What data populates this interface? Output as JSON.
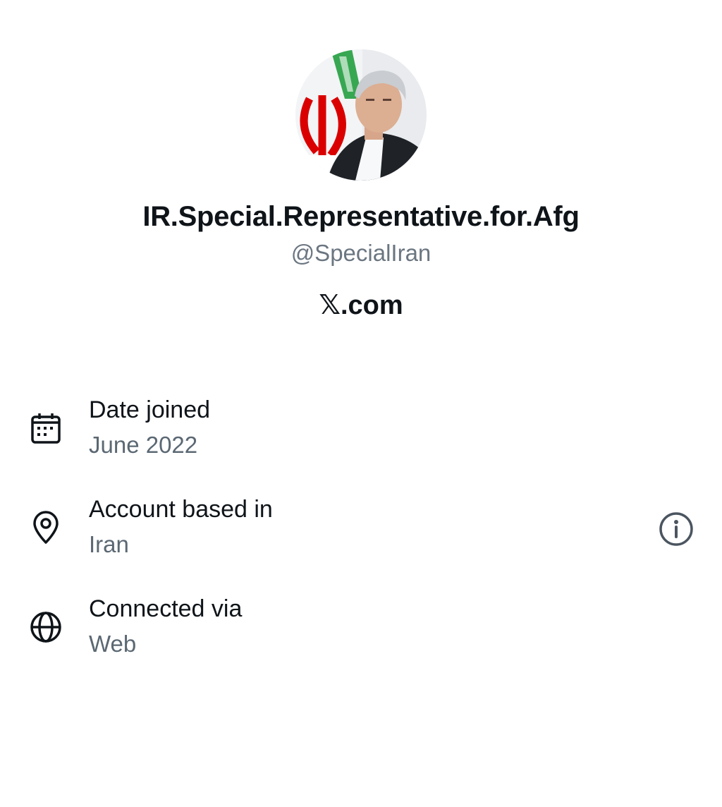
{
  "profile": {
    "display_name": "IR.Special.Representative.for.Afg",
    "handle": "@SpecialIran",
    "platform_logo": "𝕏",
    "platform_text": ".com"
  },
  "details": [
    {
      "icon": "calendar-icon",
      "label": "Date joined",
      "value": "June 2022"
    },
    {
      "icon": "location-pin-icon",
      "label": "Account based in",
      "value": "Iran",
      "action_icon": "info-icon"
    },
    {
      "icon": "globe-icon",
      "label": "Connected via",
      "value": "Web"
    }
  ],
  "colors": {
    "text_primary": "#0f1419",
    "text_secondary": "#5b6873",
    "flag_red": "#da0000",
    "flag_green": "#239f40"
  }
}
